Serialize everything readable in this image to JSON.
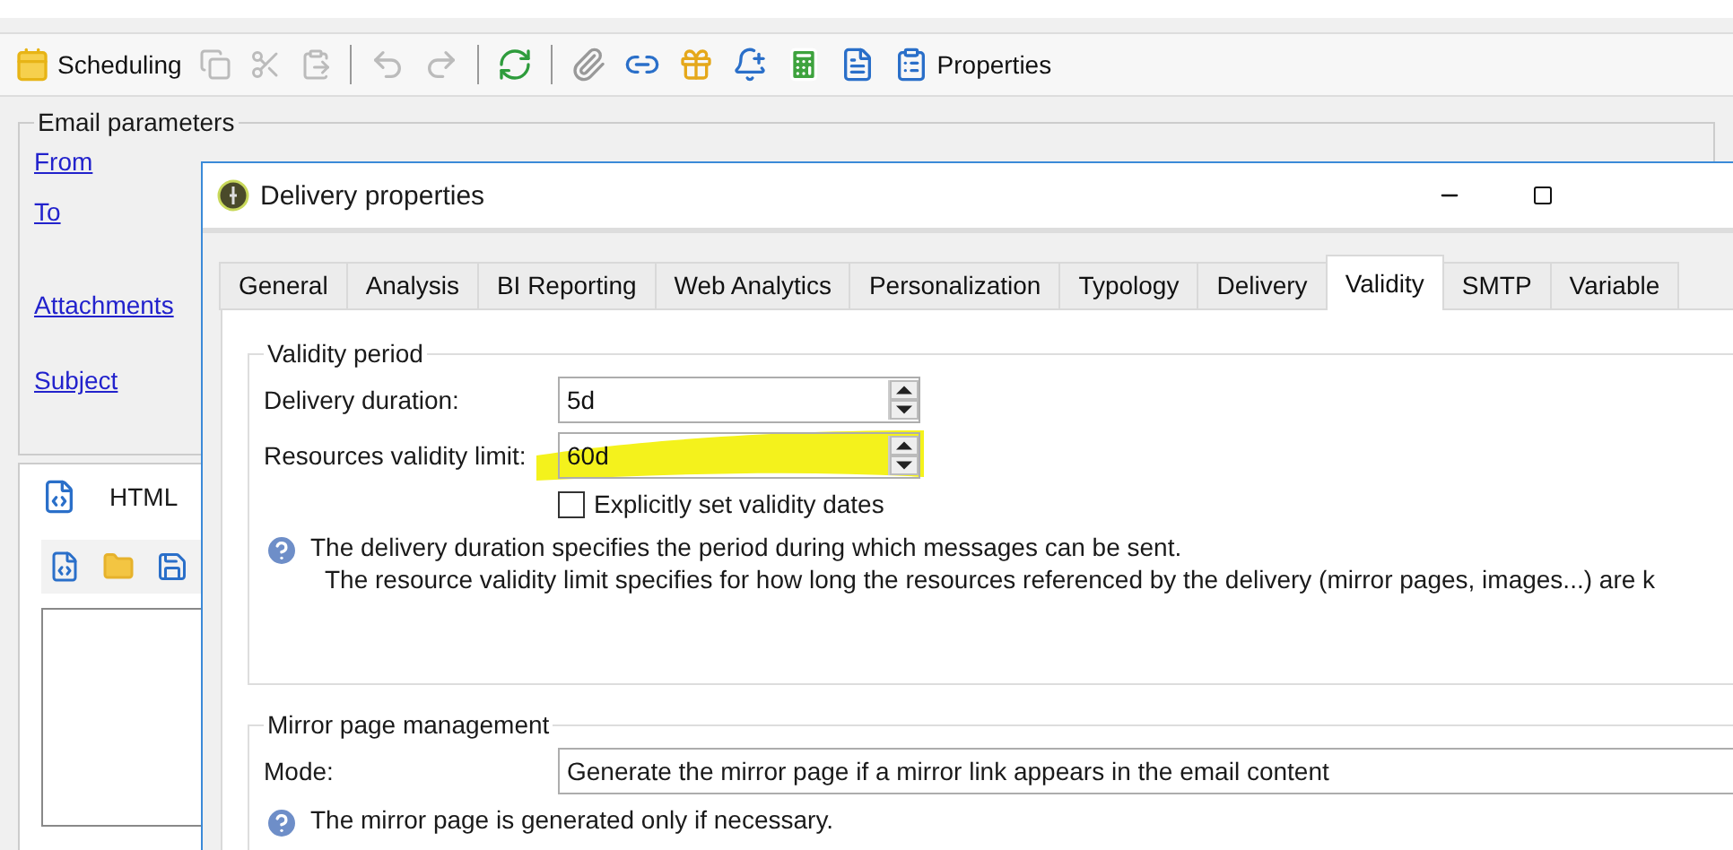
{
  "toolbar": {
    "scheduling_label": "Scheduling",
    "properties_label": "Properties",
    "clipboard_disabled": true,
    "history_disabled": true
  },
  "email_parameters": {
    "title": "Email parameters",
    "links": [
      {
        "label": "From"
      },
      {
        "label": "To"
      },
      {
        "label": "Attachments"
      },
      {
        "label": "Subject"
      }
    ]
  },
  "content_panel": {
    "title": "HTML"
  },
  "dialog": {
    "title": "Delivery properties",
    "tabs": [
      {
        "label": "General",
        "selected": false
      },
      {
        "label": "Analysis",
        "selected": false
      },
      {
        "label": "BI Reporting",
        "selected": false
      },
      {
        "label": "Web Analytics",
        "selected": false
      },
      {
        "label": "Personalization",
        "selected": false
      },
      {
        "label": "Typology",
        "selected": false
      },
      {
        "label": "Delivery",
        "selected": false
      },
      {
        "label": "Validity",
        "selected": true
      },
      {
        "label": "SMTP",
        "selected": false
      },
      {
        "label": "Variable",
        "selected": false
      }
    ],
    "validity": {
      "title": "Validity period",
      "rows": [
        {
          "label": "Delivery duration:",
          "value": "5d",
          "highlighted": false
        },
        {
          "label": "Resources validity limit:",
          "value": "60d",
          "highlighted": true
        }
      ],
      "checkbox": {
        "label": "Explicitly set validity dates",
        "checked": false
      },
      "info": [
        "The delivery duration specifies the period during which messages can be sent.",
        "The resource validity limit specifies for how long the resources referenced by the delivery (mirror pages, images...) are k"
      ]
    },
    "mirror": {
      "title": "Mirror page management",
      "mode_label": "Mode:",
      "mode_value": "Generate the mirror page if a mirror link appears in the email content",
      "info": "The mirror page is generated only if necessary."
    }
  }
}
